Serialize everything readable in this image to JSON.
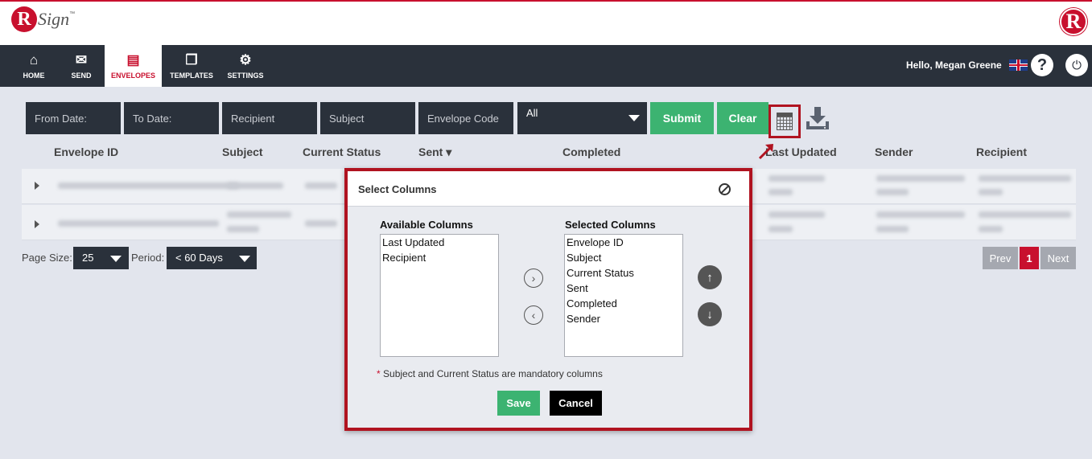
{
  "brand": {
    "logo_letter": "R",
    "logo_text": "Sign",
    "logo_tm": "™",
    "accent": "#c8102e"
  },
  "nav": {
    "items": [
      {
        "label": "HOME",
        "icon": "home-icon",
        "glyph": "⌂"
      },
      {
        "label": "SEND",
        "icon": "envelope-icon",
        "glyph": "✉"
      },
      {
        "label": "ENVELOPES",
        "icon": "inbox-icon",
        "glyph": "▤"
      },
      {
        "label": "TEMPLATES",
        "icon": "document-icon",
        "glyph": "❐"
      },
      {
        "label": "SETTINGS",
        "icon": "gear-icon",
        "glyph": "⚙"
      }
    ],
    "active": "ENVELOPES",
    "greeting": "Hello, Megan Greene",
    "help_glyph": "?",
    "power_glyph": "⏻"
  },
  "filters": {
    "from_date": "From Date:",
    "to_date": "To Date:",
    "recipient": "Recipient",
    "subject": "Subject",
    "envelope_code": "Envelope Code",
    "status_selected": "All",
    "submit": "Submit",
    "clear": "Clear"
  },
  "table": {
    "columns": [
      "Envelope ID",
      "Subject",
      "Current Status",
      "Sent",
      "Completed",
      "Last Updated",
      "Sender",
      "Recipient"
    ],
    "sort_indicator": "▾"
  },
  "pagination": {
    "page_size_label": "Page Size:",
    "page_size": "25",
    "period_label": "Period:",
    "period": "< 60 Days",
    "prev": "Prev",
    "current_page": "1",
    "next": "Next"
  },
  "modal": {
    "title": "Select Columns",
    "available_title": "Available Columns",
    "available": [
      "Last Updated",
      "Recipient"
    ],
    "selected_title": "Selected Columns",
    "selected": [
      "Envelope ID",
      "Subject",
      "Current Status",
      "Sent",
      "Completed",
      "Sender"
    ],
    "move_right_glyph": "›",
    "move_left_glyph": "‹",
    "move_up_glyph": "↑",
    "move_down_glyph": "↓",
    "note_star": "*",
    "note": "Subject and Current Status are mandatory columns",
    "save": "Save",
    "cancel": "Cancel"
  }
}
